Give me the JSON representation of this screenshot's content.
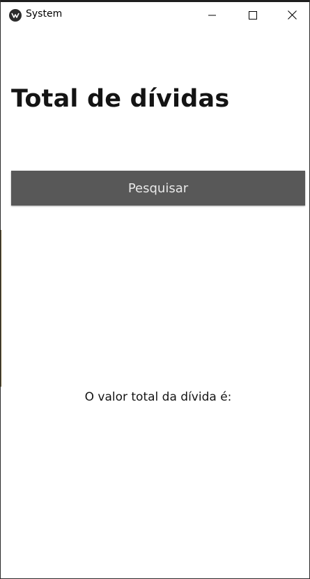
{
  "window": {
    "title": "System",
    "controls": {
      "minimize_icon": "minimize-icon",
      "maximize_icon": "maximize-icon",
      "close_icon": "close-icon"
    }
  },
  "main": {
    "title": "Total de dívidas",
    "search_button_label": "Pesquisar",
    "result_label": "O valor total da dívida é:"
  },
  "colors": {
    "button_bg": "#585858",
    "button_text": "#e8e8e8",
    "text": "#141414",
    "background": "#ffffff"
  }
}
